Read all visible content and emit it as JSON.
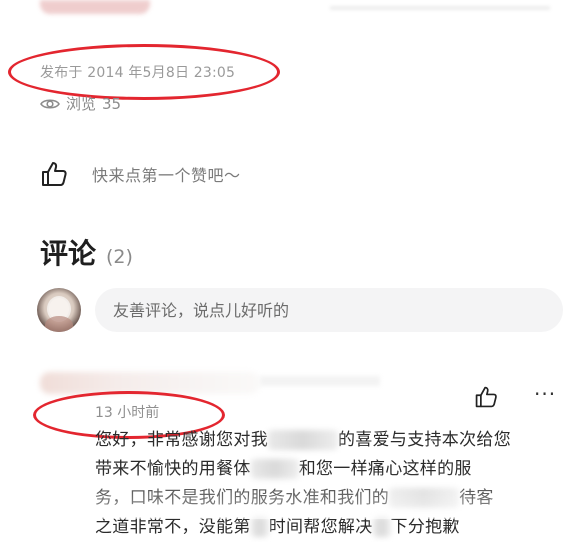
{
  "post": {
    "published_label": "发布于 2014 年5月8日 23:05",
    "views_label": "浏览",
    "views_count": "35"
  },
  "like_section": {
    "prompt": "快来点第一个赞吧～"
  },
  "comments": {
    "title": "评论",
    "count": "(2)",
    "input_placeholder": "友善评论，说点儿好听的",
    "items": [
      {
        "time": "13 小时前",
        "line1_a": "您好，非常感谢您对我",
        "line1_b": "的喜爱与支持本次给您",
        "line2_a": "带来不愉快的用餐体",
        "line2_b": "和您一样痛心这样的服",
        "line3_a": "务，口味不是我们的服务水准和我们的",
        "line3_b": "待客",
        "line4_a": "之道非常不",
        "line4_b": "，没能第",
        "line4_c": "时间帮您解决",
        "line4_d": "下分抱歉"
      }
    ]
  },
  "icons": {
    "views": "eye-icon",
    "like": "thumbs-up-icon",
    "more": "more-dots-icon"
  },
  "colors": {
    "highlight_annotation": "#e3262f",
    "muted_text": "#8f8f8f",
    "input_bg": "#f4f4f5"
  }
}
